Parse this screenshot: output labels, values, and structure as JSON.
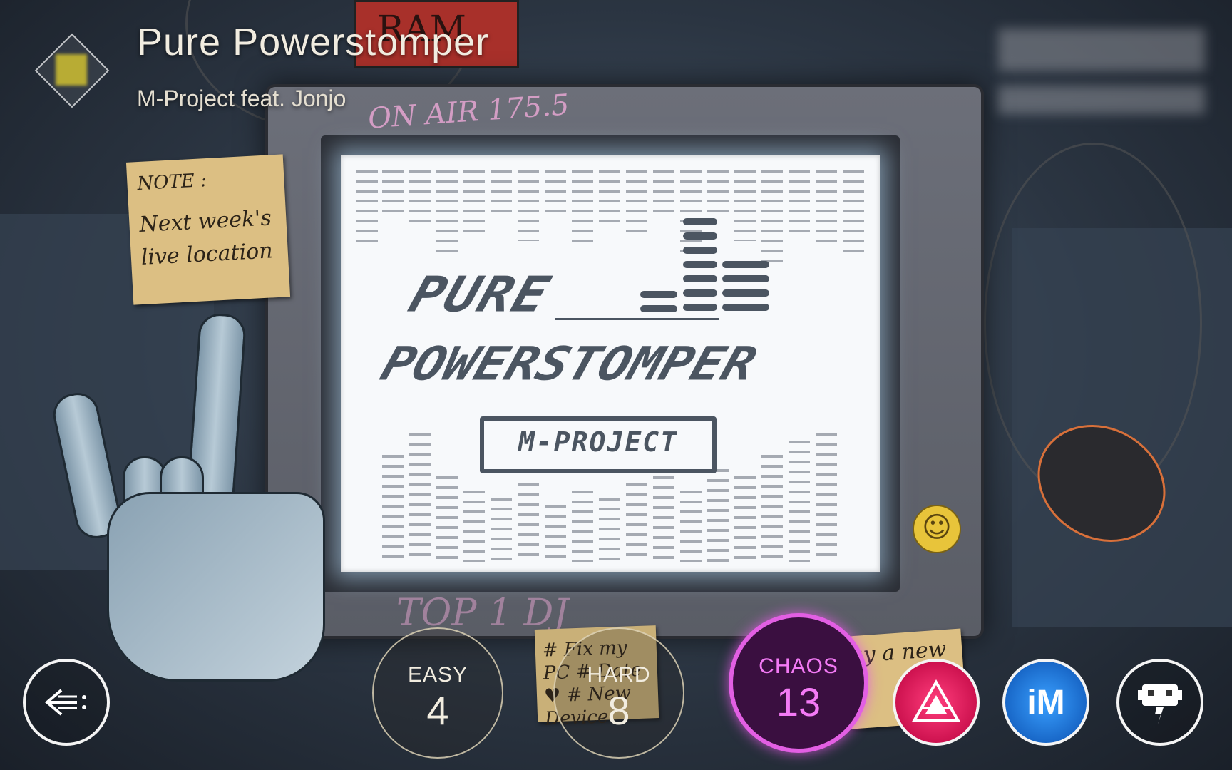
{
  "song": {
    "title": "Pure Powerstomper",
    "artist": "M-Project feat. Jonjo"
  },
  "screen_art": {
    "line1": "PURE",
    "line2": "POWERSTOMPER",
    "publisher": "M-PROJECT"
  },
  "notes": {
    "note1_title": "NOTE :",
    "note1_body": "Next week's live location",
    "note2_body": "# Fix my PC # Date ♥ # New Device",
    "note3_body": "Buy a new"
  },
  "scrawls": {
    "on_air": "ON AIR 175.5",
    "top_dj": "TOP 1 DJ",
    "ram": "RAM"
  },
  "difficulties": [
    {
      "label": "EASY",
      "level": "4"
    },
    {
      "label": "HARD",
      "level": "8"
    },
    {
      "label": "CHAOS",
      "level": "13"
    }
  ],
  "buttons": {
    "back": "back-icon",
    "skill": "skill-triangle-icon",
    "im": "iM",
    "character": "robot-icon"
  },
  "colors": {
    "chaos": "#e25fe3",
    "skill": "#e8004a",
    "im": "#1a6fe0"
  }
}
